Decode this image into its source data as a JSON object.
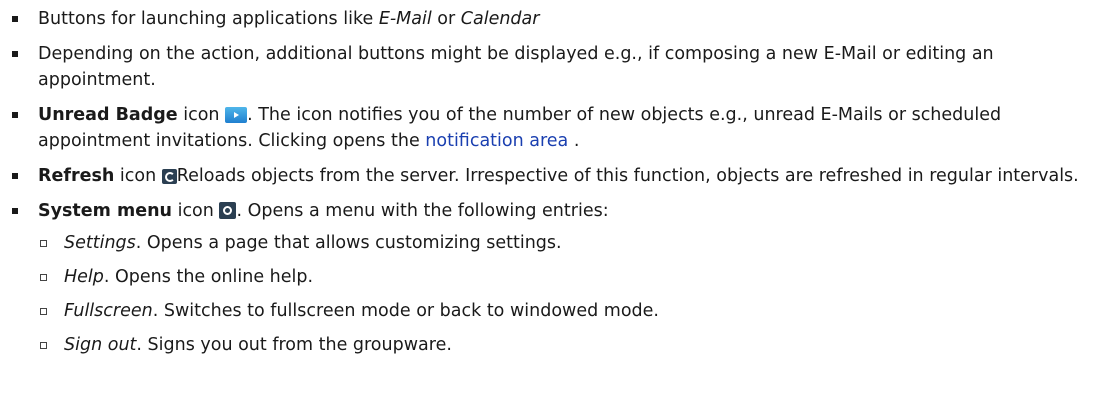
{
  "items": [
    {
      "pre": "Buttons for launching applications like ",
      "em1": "E-Mail",
      "mid": " or ",
      "em2": "Calendar"
    },
    {
      "text": "Depending on the action, additional buttons might be displayed e.g., if composing a new E-Mail or editing an appointment."
    },
    {
      "bold": "Unread Badge",
      "after_bold": " icon ",
      "after_icon": ". The icon notifies you of the number of new objects e.g., unread E-Mails or scheduled appointment invitations. Clicking opens the ",
      "link": "notification area",
      "end": " ."
    },
    {
      "bold": "Refresh",
      "after_bold": " icon ",
      "after_icon": "Reloads objects from the server. Irrespective of this function, objects are refreshed in regular intervals."
    },
    {
      "bold": "System menu",
      "after_bold": " icon ",
      "after_icon": ". Opens a menu with the following entries:",
      "sub": [
        {
          "term": "Settings",
          "desc": ". Opens a page that allows customizing settings."
        },
        {
          "term": "Help",
          "desc": ". Opens the online help."
        },
        {
          "term": "Fullscreen",
          "desc": ". Switches to fullscreen mode or back to windowed mode."
        },
        {
          "term": "Sign out",
          "desc": ". Signs you out from the groupware."
        }
      ]
    }
  ],
  "icons": {
    "unread": "unread-badge-icon",
    "refresh": "refresh-icon",
    "system": "system-menu-icon"
  }
}
